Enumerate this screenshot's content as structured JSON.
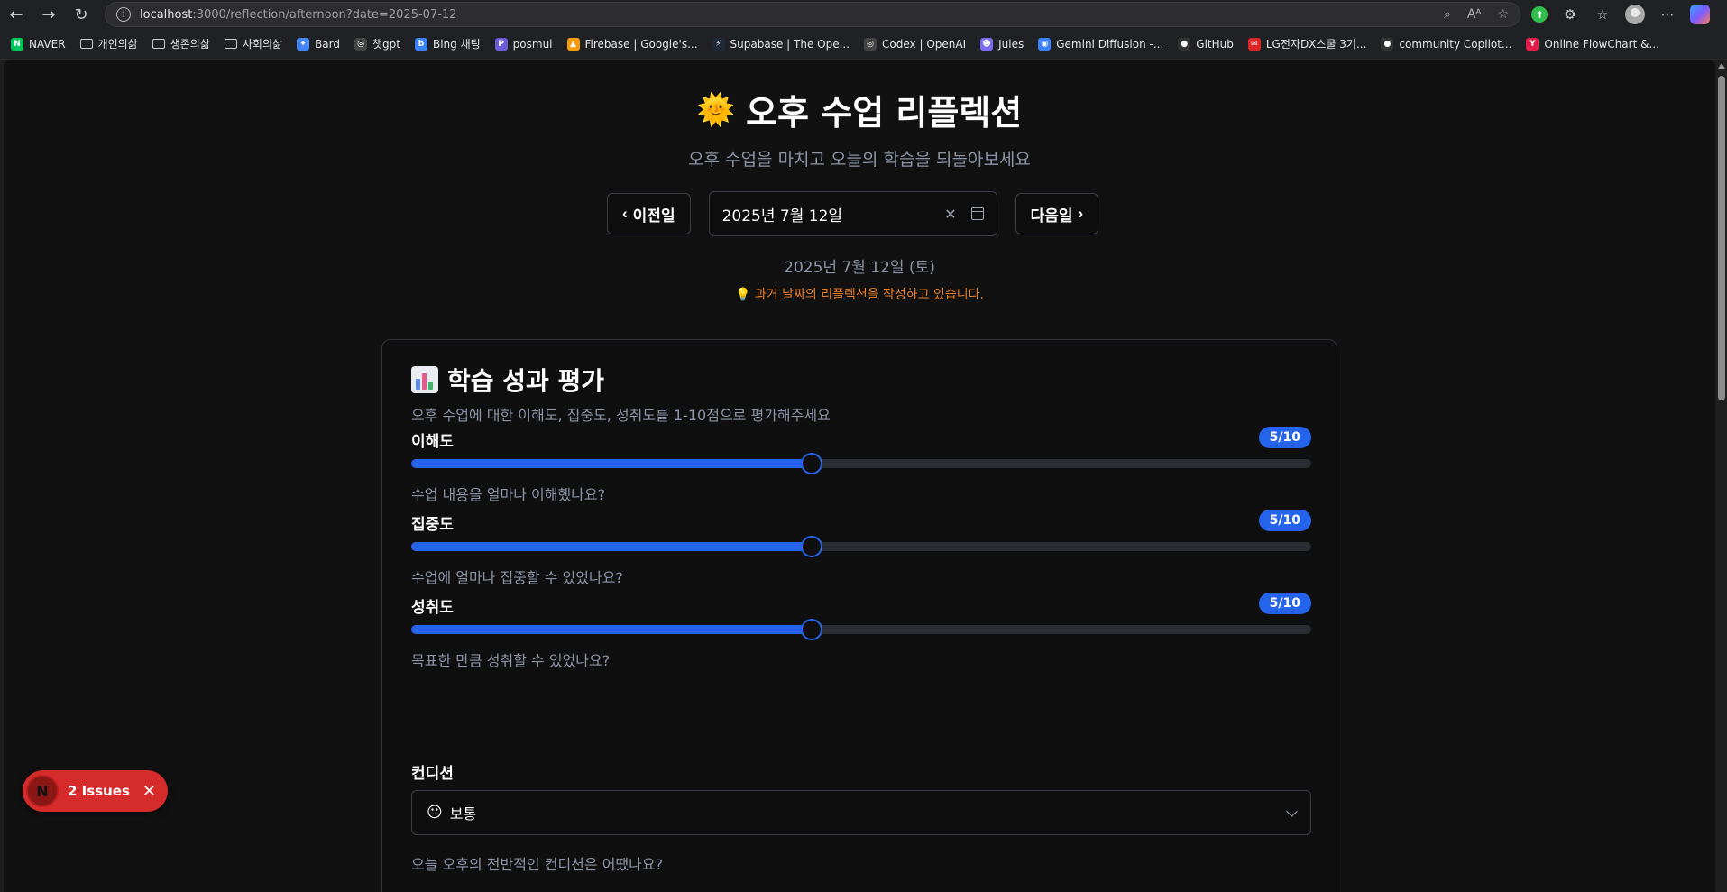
{
  "browser": {
    "url_host": "localhost",
    "url_rest": ":3000/reflection/afternoon?date=2025-07-12",
    "bookmarks": [
      {
        "label": "NAVER",
        "icon": "N",
        "color": "#03c75a"
      },
      {
        "label": "개인의삶",
        "icon": "folder"
      },
      {
        "label": "생존의삶",
        "icon": "folder"
      },
      {
        "label": "사회의삶",
        "icon": "folder"
      },
      {
        "label": "Bard",
        "icon": "✦",
        "color": "#4285f4"
      },
      {
        "label": "챗gpt",
        "icon": "◎",
        "color": "#444"
      },
      {
        "label": "Bing 채팅",
        "icon": "b",
        "color": "#3b82f6"
      },
      {
        "label": "posmul",
        "icon": "P",
        "color": "#6b5bd6"
      },
      {
        "label": "Firebase | Google's...",
        "icon": "▲",
        "color": "#f59e0b"
      },
      {
        "label": "Supabase | The Ope...",
        "icon": "⚡",
        "color": "#1f2937"
      },
      {
        "label": "Codex | OpenAI",
        "icon": "◎",
        "color": "#444"
      },
      {
        "label": "Jules",
        "icon": "☻",
        "color": "#7c6cf0"
      },
      {
        "label": "Gemini Diffusion -...",
        "icon": "◉",
        "color": "#3b82f6"
      },
      {
        "label": "GitHub",
        "icon": "●",
        "color": "#333"
      },
      {
        "label": "LG전자DX스쿨 3기...",
        "icon": "✉",
        "color": "#dc2626"
      },
      {
        "label": "community Copilot...",
        "icon": "●",
        "color": "#333"
      },
      {
        "label": "Online FlowChart &...",
        "icon": "Y",
        "color": "#e11d48"
      }
    ]
  },
  "header": {
    "title": "오후 수업 리플렉션",
    "subtitle": "오후 수업을 마치고 오늘의 학습을 되돌아보세요"
  },
  "date_nav": {
    "prev_label": "이전일",
    "next_label": "다음일",
    "date_value": "2025년 7월 12일",
    "date_display": "2025년 7월 12일 (토)",
    "notice": "과거 날짜의 리플렉션을 작성하고 있습니다."
  },
  "evaluation": {
    "title": "학습 성과 평가",
    "description": "오후 수업에 대한 이해도, 집중도, 성취도를 1-10점으로 평가해주세요",
    "metrics": [
      {
        "label": "이해도",
        "value": 5,
        "max": 10,
        "badge": "5/10",
        "help": "수업 내용을 얼마나 이해했나요?"
      },
      {
        "label": "집중도",
        "value": 5,
        "max": 10,
        "badge": "5/10",
        "help": "수업에 얼마나 집중할 수 있었나요?"
      },
      {
        "label": "성취도",
        "value": 5,
        "max": 10,
        "badge": "5/10",
        "help": "목표한 만큼 성취할 수 있었나요?"
      }
    ],
    "condition": {
      "label": "컨디션",
      "selected": "보통",
      "selected_emoji": "😐",
      "help": "오늘 오후의 전반적인 컨디션은 어땠나요?"
    }
  },
  "dev_overlay": {
    "issues_label": "2 Issues",
    "logo": "N"
  },
  "colors": {
    "accent": "#2563eb",
    "notice": "#e87f28",
    "background": "#111111"
  }
}
